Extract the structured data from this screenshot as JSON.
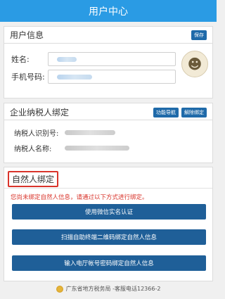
{
  "header": {
    "title": "用户中心"
  },
  "user_info": {
    "title": "用户信息",
    "save_label": "保存",
    "name_label": "姓名:",
    "phone_label": "手机号码:",
    "avatar_icon": "avatar-icon"
  },
  "taxpayer": {
    "title": "企业纳税人绑定",
    "nav_label": "功能导航",
    "unbind_label": "解除绑定",
    "id_label": "纳税人识别号:",
    "name_label": "纳税人名称:"
  },
  "natural_person": {
    "title": "自然人绑定",
    "notice": "您尚未绑定自然人信息，请通过以下方式进行绑定。",
    "buttons": [
      {
        "label": "使用微信实名认证"
      },
      {
        "label": "扫描自助终端二维码绑定自然人信息"
      },
      {
        "label": "输入电厅帐号密码绑定自然人信息"
      }
    ]
  },
  "footer": {
    "text": "广东省地方税务局 -客服电话12366-2"
  },
  "colors": {
    "header_bg": "#2a9be4",
    "button_bg": "#1f5f98",
    "alert_red": "#d9342b"
  }
}
